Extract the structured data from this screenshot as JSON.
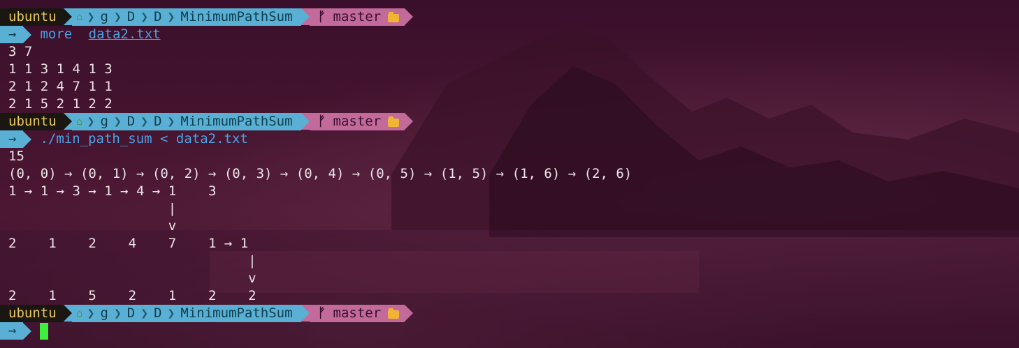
{
  "prompt": {
    "user": "ubuntu",
    "home_icon": "home-icon",
    "crumbs": [
      "g",
      "D",
      "D",
      "MinimumPathSum"
    ],
    "branch_icon": "git-branch-icon",
    "branch": "master",
    "folder_icon": "folder-icon",
    "arrow": "→"
  },
  "block1": {
    "cmd": "more",
    "arg": "data2.txt",
    "output": [
      "3 7",
      "1 1 3 1 4 1 3",
      "2 1 2 4 7 1 1",
      "2 1 5 2 1 2 2"
    ]
  },
  "block2": {
    "cmd": "./min_path_sum < data2.txt",
    "output": [
      "15",
      "(0, 0) → (0, 1) → (0, 2) → (0, 3) → (0, 4) → (0, 5) → (1, 5) → (1, 6) → (2, 6)",
      "1 → 1 → 3 → 1 → 4 → 1    3",
      "                    |",
      "                    v",
      "2    1    2    4    7    1 → 1",
      "                              |",
      "                              v",
      "2    1    5    2    1    2    2"
    ]
  },
  "colors": {
    "user_bg": "#1a1713",
    "user_fg": "#e8c85a",
    "path_bg": "#5ab0d4",
    "git_bg": "#c26a9a",
    "command": "#4aa2e6",
    "cursor": "#3ef03e"
  }
}
